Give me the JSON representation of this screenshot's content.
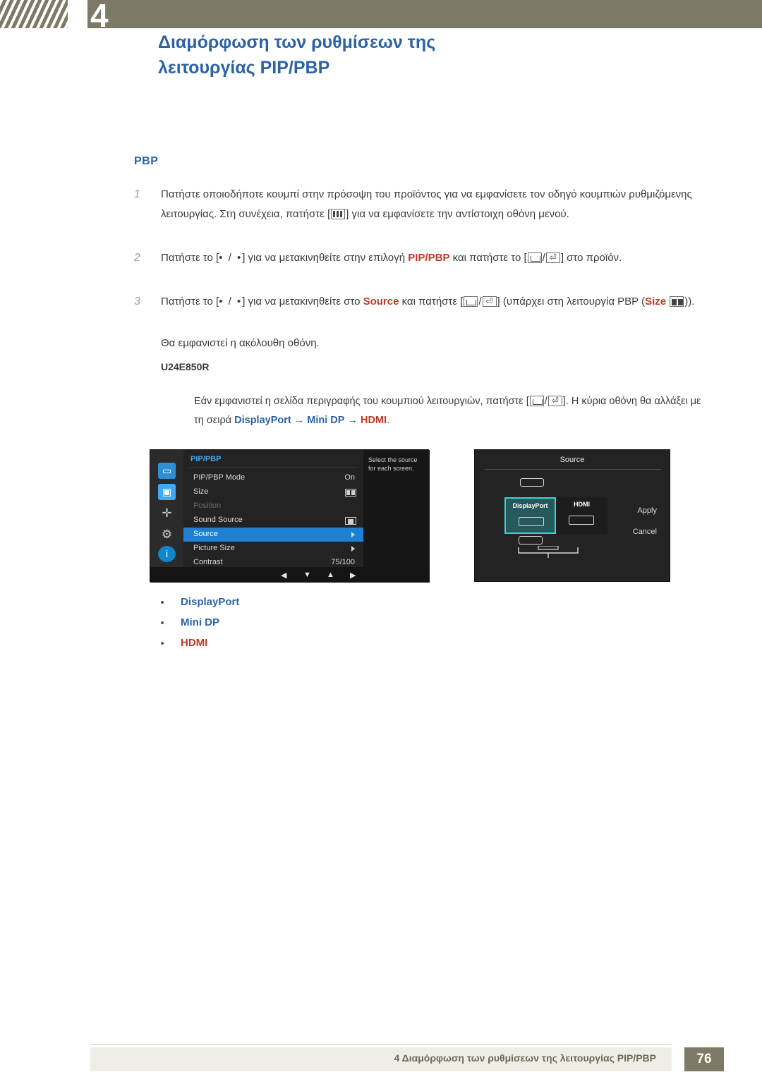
{
  "header": {
    "chapter_number": "4",
    "title_line1": "Διαμόρφωση των ρυθμίσεων της",
    "title_line2": "λειτουργίας PIP/PBP"
  },
  "section": {
    "title": "PBP"
  },
  "steps": [
    {
      "num": "1",
      "part1": "Πατήστε οποιοδήποτε κουμπί στην πρόσοψη του προϊόντος για να εμφανίσετε τον οδηγό κουμπιών ρυθμιζόμενης λειτουργίας. Στη συνέχεια, πατήστε [",
      "part2": "] για να εμφανίσετε την αντίστοιχη οθόνη μενού."
    },
    {
      "num": "2",
      "part1": "Πατήστε το [",
      "keys": "• / •",
      "part2": "] για να μετακινηθείτε στην επιλογή ",
      "bold1": "PIP/PBP",
      "part3": " και πατήστε το [",
      "part4": "] στο προϊόν."
    },
    {
      "num": "3",
      "part1": "Πατήστε το [",
      "keys": "• / •",
      "part2": "] για να μετακινηθείτε στο ",
      "bold1": "Source",
      "part3": " και πατήστε [",
      "part4": "] (υπάρχει στη λειτουργία PBP (",
      "bold2": "Size",
      "part5": "))."
    }
  ],
  "after_steps_text": "Θα εμφανιστεί η ακόλουθη οθόνη.",
  "model_label": "U24E850R",
  "note": {
    "part1": "Εάν εμφανιστεί η σελίδα περιγραφής του κουμπιού λειτουργιών, πατήστε [",
    "part2": "]. Η κύρια οθόνη θα αλλάξει με τη σειρά ",
    "src1": "DisplayPort",
    "arrow": "→",
    "src2": "Mini DP",
    "src3": "HDMI",
    "end": "."
  },
  "osd": {
    "menu_title": "PIP/PBP",
    "rows": [
      {
        "label": "PIP/PBP Mode",
        "value": "On",
        "type": "value"
      },
      {
        "label": "Size",
        "value": "",
        "type": "box-half"
      },
      {
        "label": "Position",
        "value": "",
        "type": "dim"
      },
      {
        "label": "Sound Source",
        "value": "",
        "type": "box-solid"
      },
      {
        "label": "Source",
        "value": "",
        "type": "selected-arrow"
      },
      {
        "label": "Picture Size",
        "value": "",
        "type": "arrow"
      },
      {
        "label": "Contrast",
        "value": "75/100",
        "type": "value"
      }
    ],
    "tip": "Select the source for each screen.",
    "buttons": [
      "◀",
      "▼",
      "▲",
      "▶"
    ],
    "side_icons": [
      "display-icon",
      "pip-icon",
      "position-icon",
      "settings-icon",
      "information-icon"
    ]
  },
  "source_dialog": {
    "title": "Source",
    "left_label": "DisplayPort",
    "right_label": "HDMI",
    "apply": "Apply",
    "cancel": "Cancel"
  },
  "bullets": [
    {
      "label": "DisplayPort",
      "color": "blue"
    },
    {
      "label": "Mini DP",
      "color": "blue"
    },
    {
      "label": "HDMI",
      "color": "red"
    }
  ],
  "footer": {
    "text": "4 Διαμόρφωση των ρυθμίσεων της λειτουργίας PIP/PBP",
    "page": "76"
  }
}
